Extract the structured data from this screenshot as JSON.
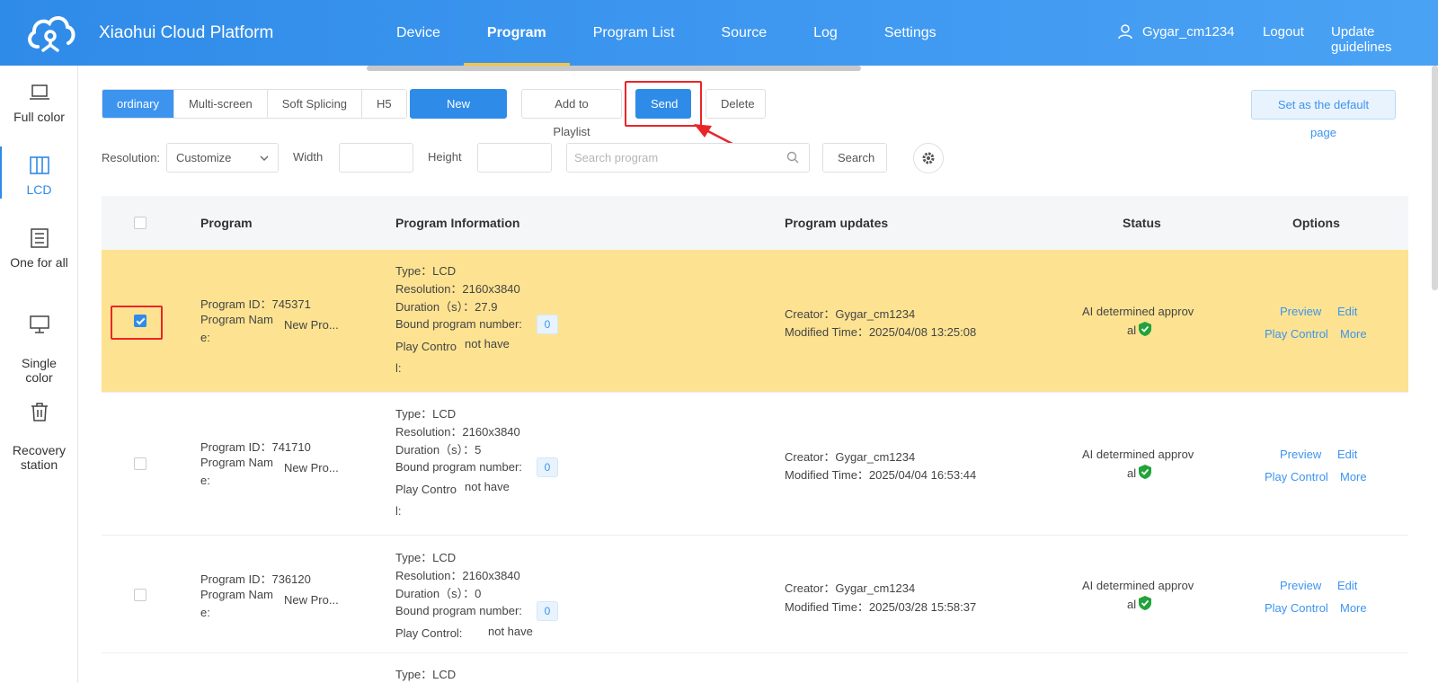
{
  "header": {
    "brand": "Xiaohui Cloud Platform",
    "nav": [
      "Device",
      "Program",
      "Program List",
      "Source",
      "Log",
      "Settings"
    ],
    "active_nav": "Program",
    "username": "Gygar_cm1234",
    "logout": "Logout",
    "update_guidelines": "Update guidelines"
  },
  "sidebar": {
    "items": [
      {
        "label": "Full color",
        "icon": "laptop-icon"
      },
      {
        "label": "LCD",
        "icon": "columns-icon"
      },
      {
        "label": "One for all",
        "icon": "list-icon"
      },
      {
        "label": "Single\ncolor",
        "icon": "monitor-icon"
      },
      {
        "label": "Recovery\nstation",
        "icon": "trash-icon"
      }
    ],
    "active": "LCD"
  },
  "toolbar": {
    "tabs": [
      "ordinary",
      "Multi-screen",
      "Soft Splicing",
      "H5"
    ],
    "active_tab": "ordinary",
    "new_program": "New Program",
    "add_to_playlist": "Add to Playlist",
    "send": "Send",
    "delete": "Delete",
    "set_default": "Set as the default page"
  },
  "filters": {
    "resolution_label": "Resolution:",
    "resolution_value": "Customize",
    "width_label": "Width",
    "height_label": "Height",
    "search_placeholder": "Search program",
    "search_button": "Search"
  },
  "table": {
    "columns": [
      "Program",
      "Program Information",
      "Program updates",
      "Status",
      "Options"
    ],
    "rows": [
      {
        "selected": true,
        "program_id": "Program ID：745371",
        "program_name_label_1": "Program Nam",
        "program_name_label_2": "e:",
        "program_name": "New Pro...",
        "type": "Type：LCD",
        "resolution": "Resolution：2160x3840",
        "duration": "Duration（s）：27.9",
        "bound_label": "Bound program number:",
        "bound_value": "0",
        "play_control_1": "Play Contro",
        "play_control_2": "l:",
        "play_control_value": "not have",
        "creator": "Creator：Gygar_cm1234",
        "modified": "Modified Time：2025/04/08 13:25:08",
        "status_1": "AI determined approv",
        "status_2": "al",
        "options": [
          "Preview",
          "Edit",
          "Play Control",
          "More"
        ]
      },
      {
        "selected": false,
        "program_id": "Program ID：741710",
        "program_name_label_1": "Program Nam",
        "program_name_label_2": "e:",
        "program_name": "New Pro...",
        "type": "Type：LCD",
        "resolution": "Resolution：2160x3840",
        "duration": "Duration（s）：5",
        "bound_label": "Bound program number:",
        "bound_value": "0",
        "play_control_1": "Play Contro",
        "play_control_2": "l:",
        "play_control_value": "not have",
        "creator": "Creator：Gygar_cm1234",
        "modified": "Modified Time：2025/04/04 16:53:44",
        "status_1": "AI determined approv",
        "status_2": "al",
        "options": [
          "Preview",
          "Edit",
          "Play Control",
          "More"
        ]
      },
      {
        "selected": false,
        "program_id": "Program ID：736120",
        "program_name_label_1": "Program Nam",
        "program_name_label_2": "e:",
        "program_name": "New Pro...",
        "type": "Type：LCD",
        "resolution": "Resolution：2160x3840",
        "duration": "Duration（s）：0",
        "bound_label": "Bound program number:",
        "bound_value": "0",
        "play_control_1": "Play Control:",
        "play_control_2": "",
        "play_control_value": "not have",
        "creator": "Creator：Gygar_cm1234",
        "modified": "Modified Time：2025/03/28 15:58:37",
        "status_1": "AI determined approv",
        "status_2": "al",
        "options": [
          "Preview",
          "Edit",
          "Play Control",
          "More"
        ]
      },
      {
        "type": "Type：LCD"
      }
    ]
  },
  "colors": {
    "primary": "#2f8be8",
    "selected_row": "#fde391",
    "highlight": "#e8262a",
    "approved_shield": "#22a33a"
  }
}
